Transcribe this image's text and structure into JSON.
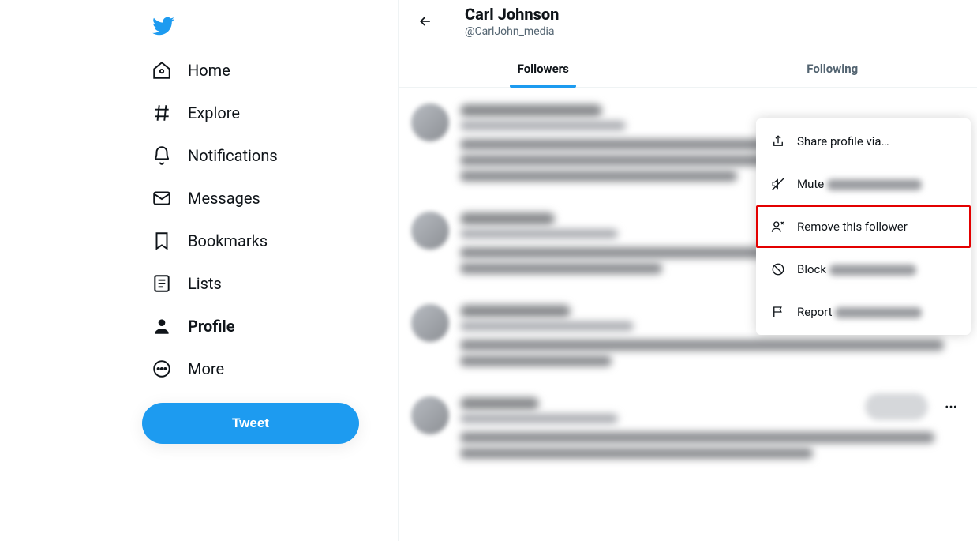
{
  "brand_color": "#1d9bf0",
  "sidebar": {
    "items": [
      {
        "label": "Home",
        "icon": "home-icon"
      },
      {
        "label": "Explore",
        "icon": "hashtag-icon"
      },
      {
        "label": "Notifications",
        "icon": "bell-icon"
      },
      {
        "label": "Messages",
        "icon": "envelope-icon"
      },
      {
        "label": "Bookmarks",
        "icon": "bookmark-icon"
      },
      {
        "label": "Lists",
        "icon": "list-icon"
      },
      {
        "label": "Profile",
        "icon": "person-icon",
        "active": true
      },
      {
        "label": "More",
        "icon": "more-circle-icon"
      }
    ],
    "tweet_button": "Tweet"
  },
  "header": {
    "name": "Carl Johnson",
    "handle": "@CarlJohn_media"
  },
  "tabs": {
    "followers": "Followers",
    "following": "Following",
    "active": "followers"
  },
  "dropdown": {
    "share": "Share profile via…",
    "mute": "Mute",
    "remove": "Remove this follower",
    "block": "Block",
    "report": "Report"
  }
}
